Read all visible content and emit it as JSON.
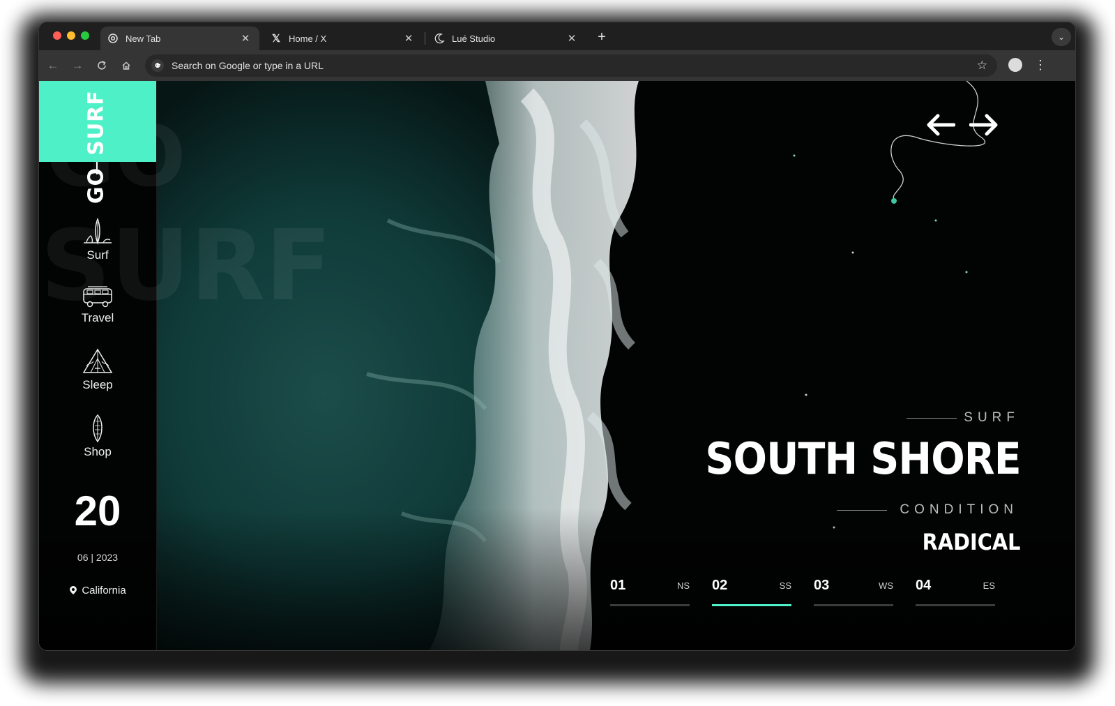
{
  "browser": {
    "tabs": [
      {
        "title": "New Tab",
        "icon": "chrome-icon",
        "active": true
      },
      {
        "title": "Home / X",
        "icon": "x-logo-icon",
        "active": false
      },
      {
        "title": "Lué Studio",
        "icon": "moon-icon",
        "active": false
      }
    ],
    "omnibox": {
      "placeholder": "Search on Google or type in a URL"
    }
  },
  "site": {
    "brand": {
      "line1": "SURF",
      "line2": "GO",
      "color": "#4ef0c8"
    },
    "bg_words": {
      "a": "GO",
      "b": "SURF"
    },
    "nav": [
      {
        "label": "Surf",
        "icon": "surfboards-icon"
      },
      {
        "label": "Travel",
        "icon": "van-icon"
      },
      {
        "label": "Sleep",
        "icon": "tent-icon"
      },
      {
        "label": "Shop",
        "icon": "surfboard-icon"
      }
    ],
    "date": {
      "day": "20",
      "month_year": "06 | 2023"
    },
    "location": "California",
    "hero": {
      "kicker": "SURF",
      "title": "SOUTH SHORE",
      "condition_label": "CONDITION",
      "condition_value": "RADICAL"
    },
    "slides": [
      {
        "num": "01",
        "code": "NS",
        "active": false
      },
      {
        "num": "02",
        "code": "SS",
        "active": true
      },
      {
        "num": "03",
        "code": "WS",
        "active": false
      },
      {
        "num": "04",
        "code": "ES",
        "active": false
      }
    ]
  }
}
